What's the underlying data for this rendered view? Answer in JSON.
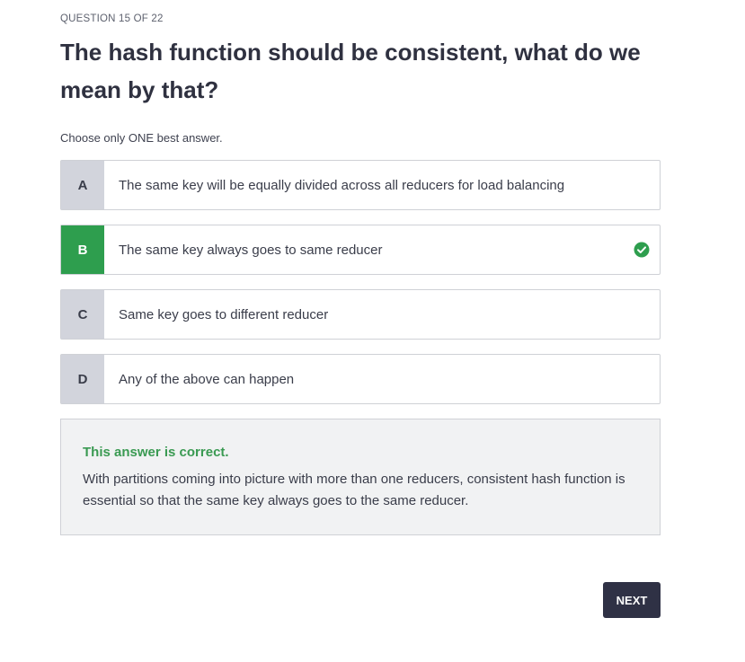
{
  "quiz": {
    "counter": "QUESTION 15 OF 22",
    "question": "The hash function should be consistent, what do we mean by that?",
    "instruction": "Choose only ONE best answer.",
    "options": [
      {
        "letter": "A",
        "text": "The same key will be equally divided across all reducers for load balancing"
      },
      {
        "letter": "B",
        "text": "The same key always goes to same reducer"
      },
      {
        "letter": "C",
        "text": "Same key goes to different reducer"
      },
      {
        "letter": "D",
        "text": "Any of the above can happen"
      }
    ],
    "selected": "B"
  },
  "feedback": {
    "title": "This answer is correct.",
    "body": "With partitions coming into picture with more than one reducers, consistent hash function is essential so that the same key always goes to the same reducer."
  },
  "actions": {
    "next_label": "NEXT"
  },
  "colors": {
    "correct": "#2e9e4e",
    "letter_bg": "#d2d4dc",
    "button": "#2f3145"
  },
  "icons": {
    "correct": "check-circle-icon"
  }
}
